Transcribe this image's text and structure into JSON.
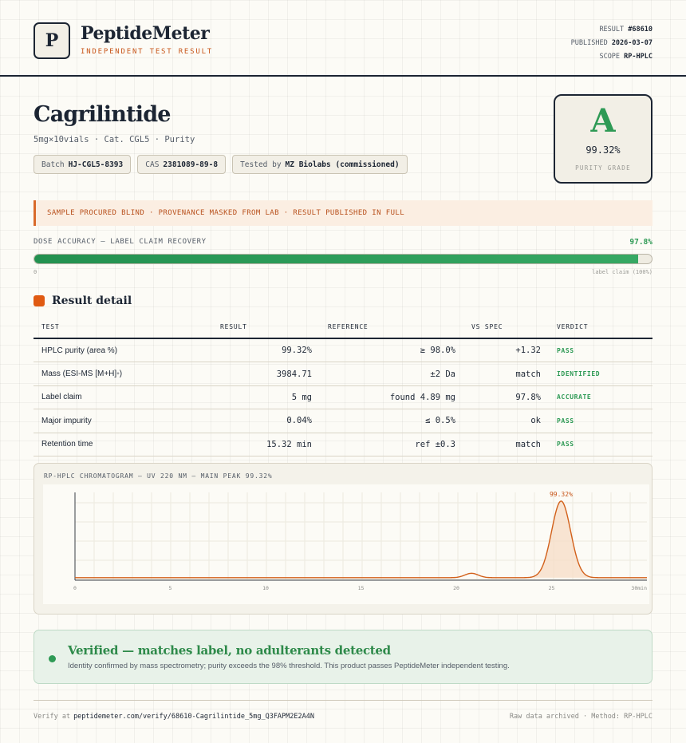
{
  "header": {
    "logo_letter": "P",
    "brand": "PeptideMeter",
    "subtitle": "INDEPENDENT TEST RESULT",
    "meta": {
      "result_label": "RESULT",
      "result_value": "#68610",
      "published_label": "PUBLISHED",
      "published_value": "2026-03-07",
      "scope_label": "SCOPE",
      "scope_value": "RP-HPLC"
    }
  },
  "product": {
    "name": "Cagrilintide",
    "subline": "5mg×10vials · Cat. CGL5 · Purity",
    "chips": {
      "batch_label": "Batch",
      "batch_value": "HJ-CGL5-8393",
      "cas_label": "CAS",
      "cas_value": "2381089-89-8",
      "tested_label": "Tested by",
      "tested_value": "MZ Biolabs (commissioned)"
    }
  },
  "grade": {
    "letter": "A",
    "value": "99.32%",
    "label": "PURITY GRADE"
  },
  "notice": "SAMPLE PROCURED BLIND · PROVENANCE MASKED FROM LAB · RESULT PUBLISHED IN FULL",
  "dose": {
    "label": "DOSE ACCURACY — LABEL CLAIM RECOVERY",
    "value": "97.8%",
    "fraction": 0.978,
    "min_label": "0",
    "max_label": "label claim (100%)"
  },
  "results": {
    "title": "Result detail",
    "headers": {
      "test": "TEST",
      "result": "RESULT",
      "reference": "REFERENCE",
      "vs_spec": "VS SPEC",
      "verdict": "VERDICT"
    },
    "rows": [
      {
        "test": "HPLC purity (area %)",
        "result": "99.32%",
        "reference": "≥ 98.0%",
        "vs_spec": "+1.32",
        "verdict": "PASS"
      },
      {
        "test": "Mass (ESI-MS [M+H]",
        "test_sup": "+",
        "test_close": ")",
        "result": "3984.71",
        "reference": "±2 Da",
        "vs_spec": "match",
        "verdict": "IDENTIFIED"
      },
      {
        "test": "Label claim",
        "result": "5 mg",
        "reference": "found 4.89 mg",
        "vs_spec": "97.8%",
        "verdict": "ACCURATE"
      },
      {
        "test": "Major impurity",
        "result": "0.04%",
        "reference": "≤ 0.5%",
        "vs_spec": "ok",
        "verdict": "PASS"
      },
      {
        "test": "Retention time",
        "result": "15.32 min",
        "reference": "ref ±0.3",
        "vs_spec": "match",
        "verdict": "PASS"
      }
    ]
  },
  "chromatogram": {
    "title": "RP-HPLC CHROMATOGRAM — UV 220 NM — MAIN PEAK 99.32%",
    "peak_label": "99.32%",
    "line_color": "#d2601a",
    "x_ticks": [
      "0",
      "5",
      "10",
      "15",
      "20",
      "25",
      "30"
    ],
    "x_unit": "min"
  },
  "chart_data": {
    "type": "line",
    "title": "RP-HPLC CHROMATOGRAM — UV 220 NM — MAIN PEAK 99.32%",
    "xlabel": "",
    "ylabel": "",
    "xlim": [
      0,
      30
    ],
    "ylim": [
      0,
      100
    ],
    "grid": true,
    "x_ticks": [
      0,
      5,
      10,
      15,
      20,
      25,
      30
    ],
    "baseline": 2,
    "peaks": [
      {
        "x": 20.8,
        "height": 5,
        "width": 0.35,
        "label": ""
      },
      {
        "x": 25.5,
        "height": 88,
        "width": 0.5,
        "label": "99.32%"
      }
    ]
  },
  "verified": {
    "title": "Verified — matches label, no adulterants detected",
    "text": "Identity confirmed by mass spectrometry; purity exceeds the 98% threshold. This product passes PeptideMeter independent testing."
  },
  "footer": {
    "verify_label": "Verify at",
    "verify_url": "peptidemeter.com/verify/68610-Cagrilintide_5mg_Q3FAPM2E2A4N",
    "right_text": "Raw data archived · Method: RP-HPLC"
  },
  "colors": {
    "accent": "#c8561a",
    "pass": "#2e9a55",
    "ink": "#1c2533"
  }
}
